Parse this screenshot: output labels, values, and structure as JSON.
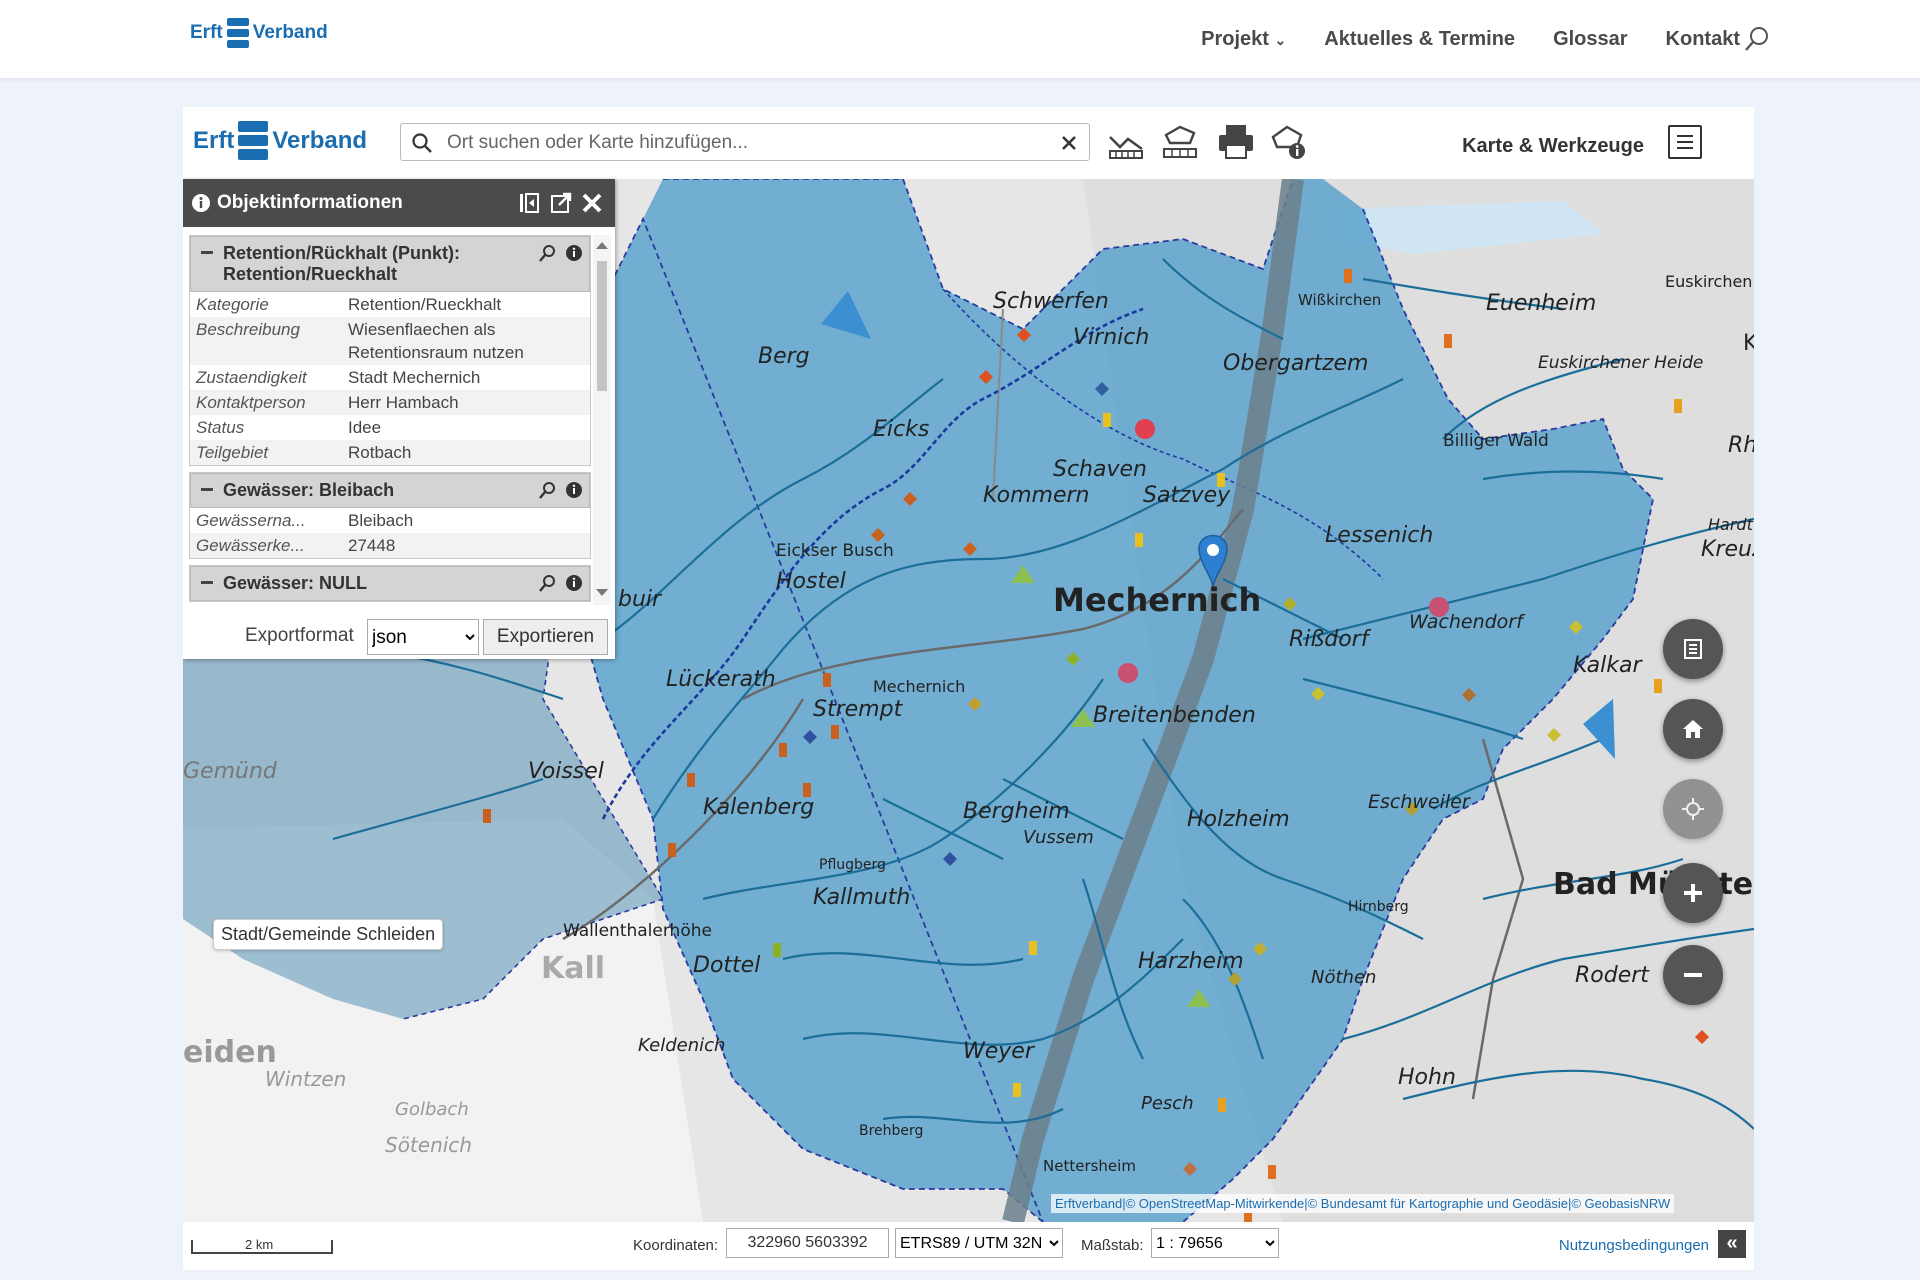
{
  "site": {
    "logo_text_1": "Erft",
    "logo_text_2": "Verband",
    "nav": [
      "Projekt",
      "Aktuelles & Termine",
      "Glossar",
      "Kontakt"
    ]
  },
  "app": {
    "logo_text_1": "Erft",
    "logo_text_2": "Verband",
    "search_placeholder": "Ort suchen oder Karte hinzufügen...",
    "tools_label": "Karte & Werkzeuge"
  },
  "info_panel": {
    "title": "Objektinformationen",
    "sections": [
      {
        "title": "Retention/Rückhalt (Punkt): Retention/Rueckhalt",
        "rows": [
          {
            "k": "Kategorie",
            "v": "Retention/Rueckhalt"
          },
          {
            "k": "Beschreibung",
            "v": "Wiesenflaechen als Retentionsraum nutzen"
          },
          {
            "k": "Zustaendigkeit",
            "v": "Stadt Mechernich"
          },
          {
            "k": "Kontaktperson",
            "v": "Herr Hambach"
          },
          {
            "k": "Status",
            "v": "Idee"
          },
          {
            "k": "Teilgebiet",
            "v": "Rotbach"
          }
        ]
      },
      {
        "title": "Gewässer: Bleibach",
        "rows": [
          {
            "k": "Gewässerna...",
            "v": "Bleibach"
          },
          {
            "k": "Gewässerke...",
            "v": "27448"
          }
        ]
      },
      {
        "title": "Gewässer: NULL",
        "rows": []
      }
    ],
    "export_label": "Exportformat",
    "export_format": "json",
    "export_button": "Exportieren"
  },
  "map_labels": {
    "places": [
      "Schwerfen",
      "Virnich",
      "Obergartzem",
      "Euenheim",
      "Euskirchen",
      "Kuchen",
      "Euskirchener Heide",
      "Berg",
      "Eicks",
      "Schaven",
      "Kommern",
      "Satzvey",
      "Billiger Wald",
      "Eickser Busch",
      "Hostel",
      "Mechernich",
      "Lessenich",
      "Wachendorf",
      "Rißdorf",
      "Kalkar",
      "Hardt",
      "Kreuzwe",
      "Lückerath",
      "Strempt",
      "Breitenbenden",
      "Voissel",
      "Kalenberg",
      "Bergheim",
      "Vussem",
      "Holzheim",
      "Eschweiler",
      "Bad Münster",
      "Kallmuth",
      "Wallenthalerhöhe",
      "Dottel",
      "Harzheim",
      "Nöthen",
      "Rodert",
      "Kall",
      "Keldenich",
      "Weyer",
      "Hohn",
      "Pesch",
      "Golbach",
      "Sötenich",
      "Wintzen",
      "Nettersheim",
      "Gemünd",
      "Wißkirchen",
      "Pflugberg",
      "Brehberg",
      "Hirnberg",
      "Mechernich",
      "eiden",
      "buir",
      "Rh"
    ],
    "hover_tooltip": "Stadt/Gemeinde Schleiden"
  },
  "attribution": "Erftverband|© OpenStreetMap-Mitwirkende|© Bundesamt für Kartographie und Geodäsie|© GeobasisNRW",
  "status_bar": {
    "scale_text": "2 km",
    "coord_label": "Koordinaten:",
    "coord_value": "322960 5603392",
    "crs": "ETRS89 / UTM 32N",
    "scale_label": "Maßstab:",
    "scale_value": "1 : 79656",
    "terms": "Nutzungsbedingungen",
    "collapse": "«"
  },
  "colors": {
    "brand": "#1a6db0",
    "catchment_fill": "#5ca3cc",
    "river": "#1b6e99",
    "header_dark": "#4b4b4b"
  }
}
